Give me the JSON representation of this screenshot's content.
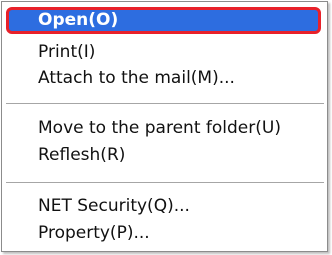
{
  "context_menu": {
    "items": [
      {
        "label": "Open(O)",
        "selected": true
      },
      {
        "label": "Print(I)"
      },
      {
        "label": "Attach to the mail(M)..."
      },
      {
        "label": "Move to the parent folder(U)"
      },
      {
        "label": "Reflesh(R)"
      },
      {
        "label": "NET Security(Q)..."
      },
      {
        "label": "Property(P)..."
      }
    ],
    "highlight_color": "#2d6de0",
    "highlight_border_color": "#e8212a"
  }
}
